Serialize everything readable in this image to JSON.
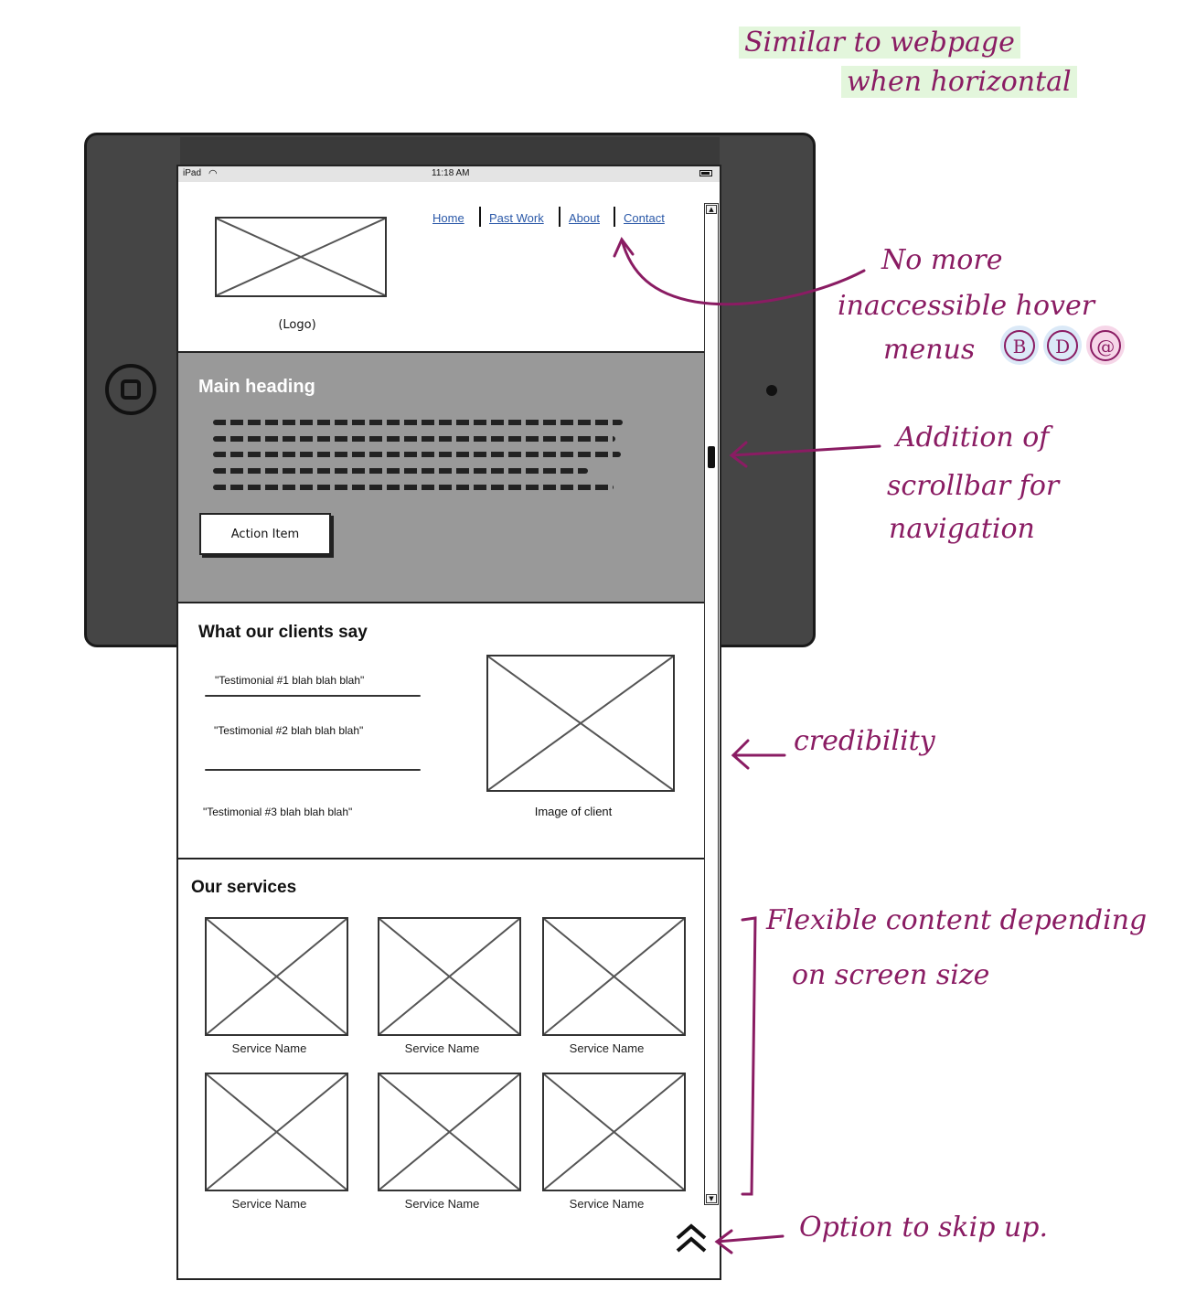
{
  "status_bar": {
    "carrier": "iPad",
    "time": "11:18 AM"
  },
  "header": {
    "logo_caption": "(Logo)"
  },
  "nav": {
    "items": [
      "Home",
      "Past Work",
      "About",
      "Contact"
    ]
  },
  "hero": {
    "heading": "Main heading",
    "action_label": "Action Item"
  },
  "testimonials": {
    "title": "What our clients say",
    "items": [
      "\"Testimonial #1 blah blah blah\"",
      "\"Testimonial #2 blah blah blah\"",
      "\"Testimonial #3 blah blah blah\""
    ],
    "image_caption": "Image of client"
  },
  "services": {
    "title": "Our services",
    "items": [
      "Service Name",
      "Service Name",
      "Service Name",
      "Service Name",
      "Service Name",
      "Service Name"
    ]
  },
  "annotations": {
    "top_line1": "Similar to webpage",
    "top_line2": "when horizontal",
    "nav_note_line1": "No more",
    "nav_note_line2": "inaccessible hover",
    "nav_note_line3": "menus",
    "badges": [
      "B",
      "D",
      "@"
    ],
    "scroll_note_line1": "Addition of",
    "scroll_note_line2": "scrollbar for",
    "scroll_note_line3": "navigation",
    "credibility": "credibility",
    "flex_line1": "Flexible content depending",
    "flex_line2": "on screen size",
    "skip_up": "Option to skip up."
  },
  "colors": {
    "annotation": "#8a1c63",
    "hero_bg": "#999999",
    "link": "#2a58a8",
    "highlight_green": "#e3f6dc"
  }
}
